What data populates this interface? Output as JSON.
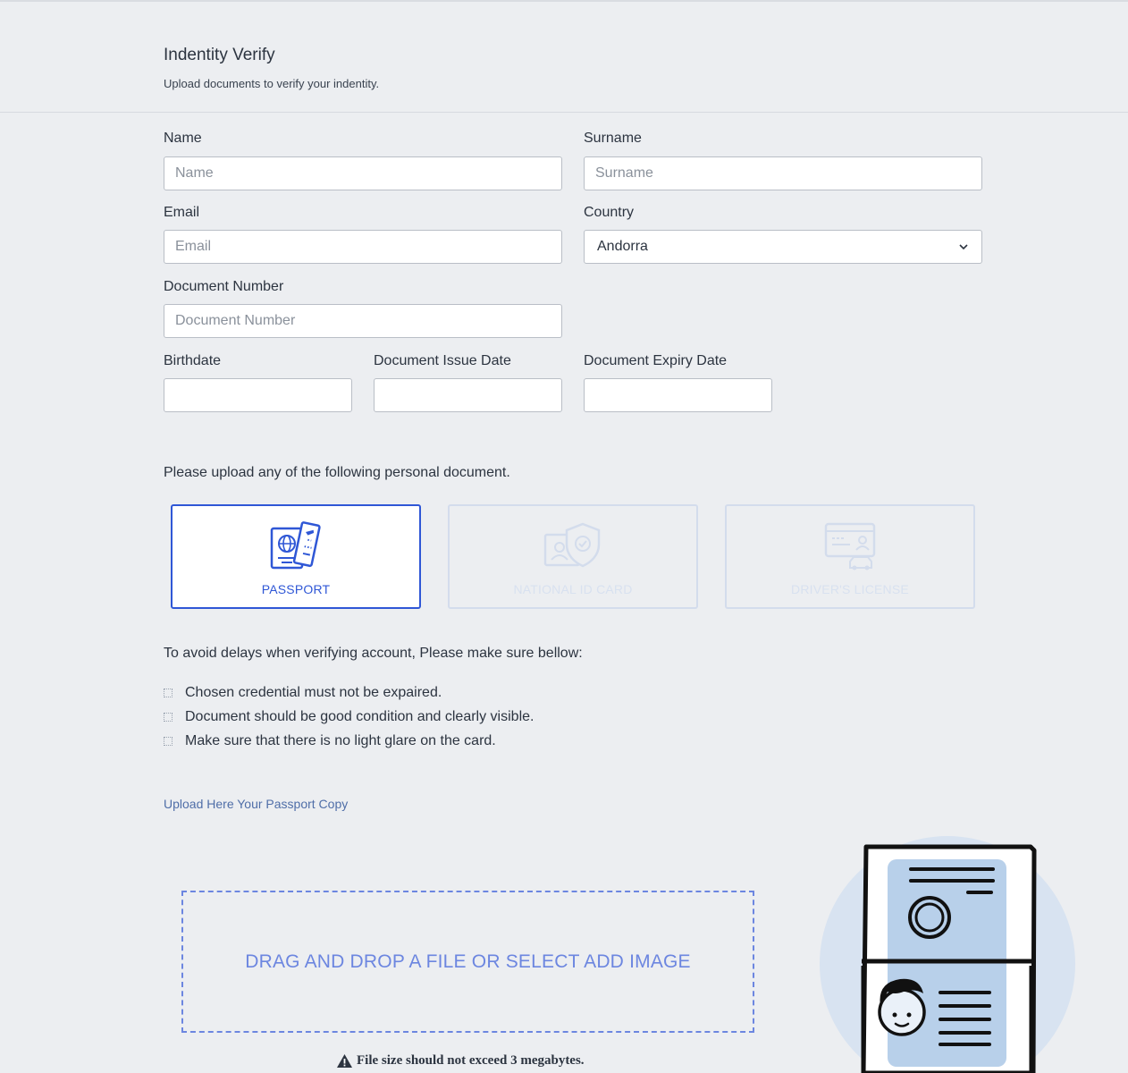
{
  "header": {
    "title": "Indentity Verify",
    "subtitle": "Upload documents to verify your indentity."
  },
  "form": {
    "name": {
      "label": "Name",
      "placeholder": "Name",
      "value": ""
    },
    "surname": {
      "label": "Surname",
      "placeholder": "Surname",
      "value": ""
    },
    "email": {
      "label": "Email",
      "placeholder": "Email",
      "value": ""
    },
    "country": {
      "label": "Country",
      "value": "Andorra"
    },
    "document_number": {
      "label": "Document Number",
      "placeholder": "Document Number",
      "value": ""
    },
    "birthdate": {
      "label": "Birthdate",
      "value": ""
    },
    "issue_date": {
      "label": "Document Issue Date",
      "value": ""
    },
    "expiry_date": {
      "label": "Document Expiry Date",
      "value": ""
    }
  },
  "documents": {
    "prompt": "Please upload any of the following personal document.",
    "options": [
      {
        "label": "PASSPORT",
        "icon": "passport-icon",
        "selected": true
      },
      {
        "label": "NATIONAL ID CARD",
        "icon": "id-card-icon",
        "selected": false
      },
      {
        "label": "DRIVER'S LICENSE",
        "icon": "drivers-license-icon",
        "selected": false
      }
    ]
  },
  "requirements": {
    "intro": "To avoid delays when verifying account, Please make sure bellow:",
    "items": [
      "Chosen credential must not be expaired.",
      "Document should be good condition and clearly visible.",
      "Make sure that there is no light glare on the card."
    ]
  },
  "upload": {
    "link_text": "Upload Here Your Passport Copy",
    "dropzone_text": "DRAG AND DROP A FILE OR SELECT ADD IMAGE",
    "size_note": "File size should not exceed 3 megabytes."
  },
  "colors": {
    "accent": "#2f57d6",
    "dropzone": "#6c86e0",
    "background": "#eceef1",
    "illustration_card": "#b8d0ea"
  }
}
